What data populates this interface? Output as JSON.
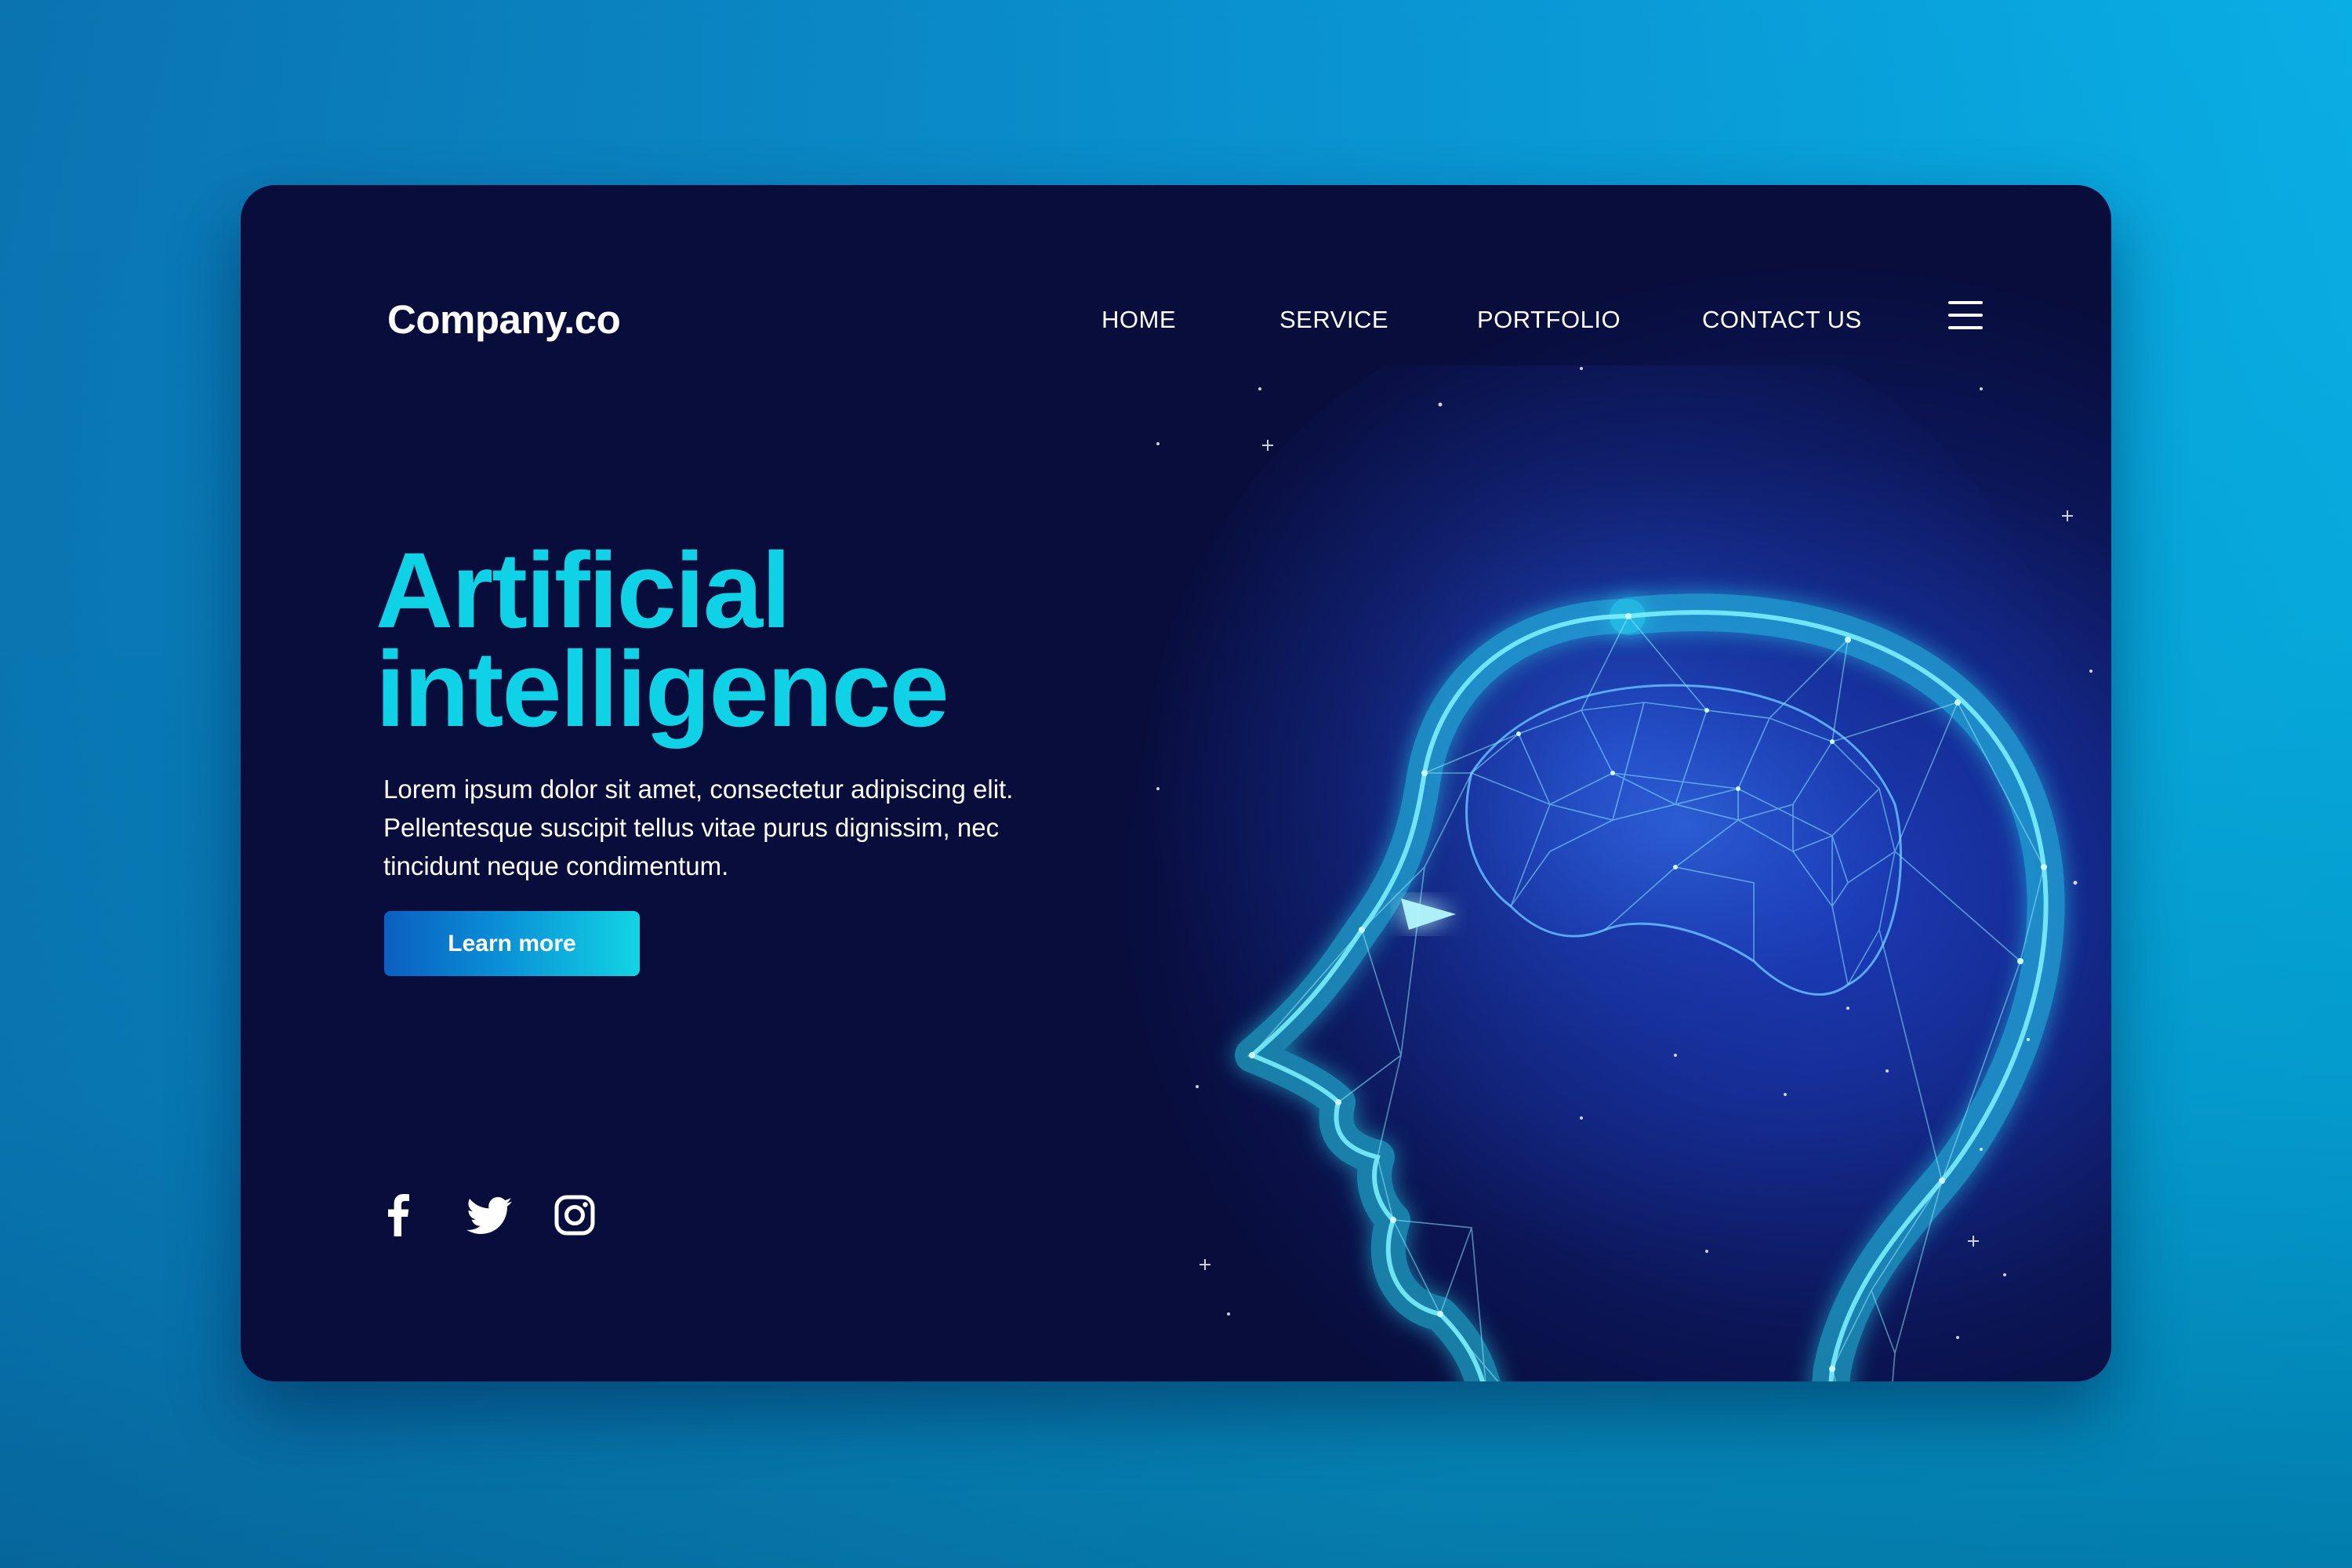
{
  "brand": {
    "logo": "Company.co"
  },
  "nav": {
    "items": [
      {
        "label": "HOME"
      },
      {
        "label": "SERVICE"
      },
      {
        "label": "PORTFOLIO"
      },
      {
        "label": "CONTACT US"
      }
    ],
    "menu_icon": "hamburger-menu-icon"
  },
  "hero": {
    "title_line1": "Artificial",
    "title_line2": "intelligence",
    "body": "Lorem ipsum dolor sit amet, consectetur adipiscing elit. Pellentesque suscipit tellus vitae purus dignissim, nec tincidunt neque condimentum.",
    "cta_label": "Learn more",
    "illustration_icon": "polygonal-human-head-illustration"
  },
  "social": [
    {
      "icon": "facebook-icon"
    },
    {
      "icon": "twitter-icon"
    },
    {
      "icon": "instagram-icon"
    }
  ],
  "colors": {
    "accent": "#10d2e6",
    "card_background": "#080d3c",
    "page_background": "#08bdf0",
    "button_gradient_start": "#0b5fc0",
    "button_gradient_end": "#13d4e3",
    "text": "#ffffff"
  }
}
